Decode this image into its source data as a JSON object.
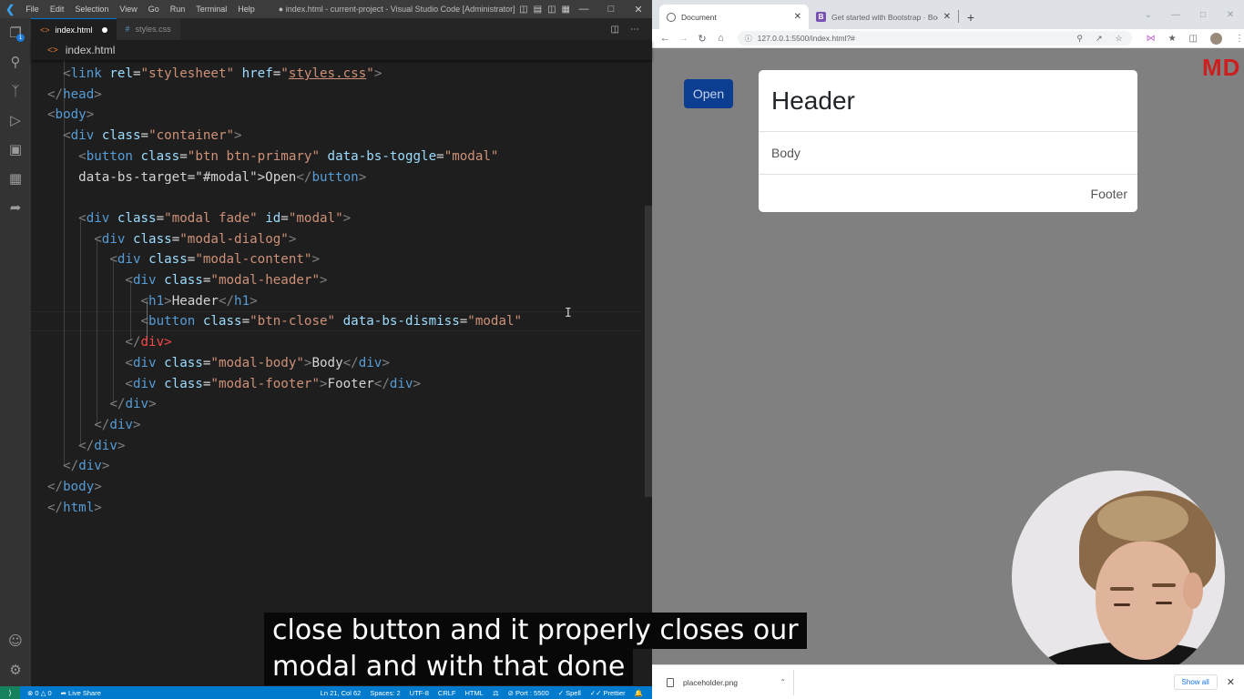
{
  "vscode": {
    "menu": [
      "File",
      "Edit",
      "Selection",
      "View",
      "Go",
      "Run",
      "Terminal",
      "Help"
    ],
    "window_title": "● index.html - current-project - Visual Studio Code [Administrator] [Unsuppo...",
    "tabs": [
      {
        "label": "index.html",
        "active": true,
        "modified": true
      },
      {
        "label": "styles.css",
        "active": false
      }
    ],
    "breadcrumb": "index.html",
    "explorer_badge": "1",
    "status": {
      "errors": "0",
      "warnings": "0",
      "live_share": "Live Share",
      "position": "Ln 21, Col 62",
      "spaces": "Spaces: 2",
      "encoding": "UTF-8",
      "eol": "CRLF",
      "language": "HTML",
      "port": "Port : 5500",
      "spell": "Spell",
      "prettier": "Prettier"
    },
    "code_lines": [
      "  <link rel=\"stylesheet\" href=\"styles.css\">",
      "</head>",
      "<body>",
      "  <div class=\"container\">",
      "    <button class=\"btn btn-primary\" data-bs-toggle=\"modal\"",
      "    data-bs-target=\"#modal\">Open</button>",
      "",
      "    <div class=\"modal fade\" id=\"modal\">",
      "      <div class=\"modal-dialog\">",
      "        <div class=\"modal-content\">",
      "          <div class=\"modal-header\">",
      "            <h1>Header</h1>",
      "            <button class=\"btn-close\" data-bs-dismiss=\"modal\"",
      "          </div>",
      "          <div class=\"modal-body\">Body</div>",
      "          <div class=\"modal-footer\">Footer</div>",
      "        </div>",
      "      </div>",
      "    </div>",
      "  </div>",
      "</body>",
      "</html>"
    ]
  },
  "browser": {
    "tabs": [
      {
        "title": "Document",
        "active": true
      },
      {
        "title": "Get started with Bootstrap · Boo",
        "active": false
      }
    ],
    "url": "127.0.0.1:5500/index.html?#",
    "page": {
      "open_button": "Open",
      "corner_logo": "MD",
      "modal_header": "Header",
      "modal_body": "Body",
      "modal_footer": "Footer"
    },
    "download": {
      "filename": "placeholder.png",
      "show_all": "Show all"
    }
  },
  "captions": [
    "close button and it properly closes our",
    "modal and with that done"
  ],
  "colors": {
    "vscode_statusbar": "#007acc",
    "bootstrap_primary": "#0b3d91",
    "logo_red": "#cc1f1f",
    "backdrop": "#808080"
  }
}
